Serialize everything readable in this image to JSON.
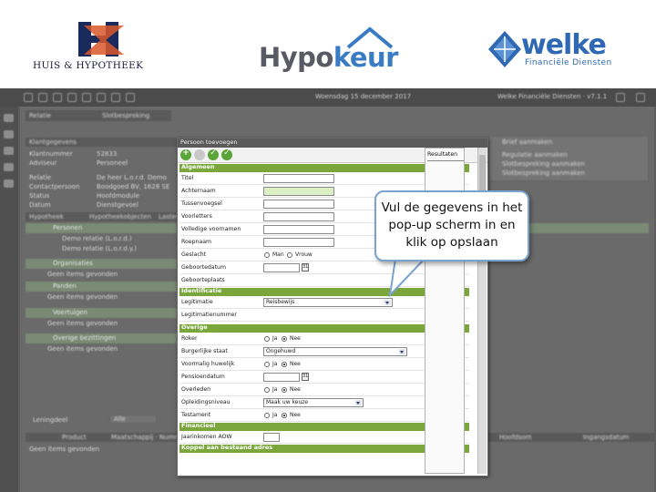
{
  "logos": {
    "huis_hypotheek": "HUIS & HYPOTHEEK",
    "hypokeur_a": "Hypo",
    "hypokeur_b": "keur",
    "welke": "welke",
    "welke_sub": "Financiële Diensten"
  },
  "colors": {
    "section_green": "#7aa63c",
    "required_field": "#dcf0c6",
    "welke_blue": "#2f69b4",
    "hypokeur_blue": "#3a7cc4",
    "callout_border": "#7aa2d0"
  },
  "app": {
    "topbar_date": "Woensdag 15 december 2017",
    "topbar_user": "Welke Financiële Diensten · v7.1.1",
    "tab_label": "Relatie",
    "tab_sub": "Slotbespreking",
    "relatie_header": "Klantgegevens",
    "right_panel": {
      "title": "Brief aanmaken",
      "items": [
        "Regulatie aanmaken",
        "Slotbespreking aanmaken",
        "Slotbespreking aanmaken"
      ]
    },
    "left_rows": [
      {
        "label": "Klantnummer",
        "value": "52833"
      },
      {
        "label": "Adviseur",
        "value": "Personeel"
      },
      {
        "label": "Relatie",
        "value": "De heer L.o.r.d. Demo"
      },
      {
        "label": "Contactpersoon",
        "value": "Boodgoed BV, 1628 SE"
      },
      {
        "label": "Status",
        "value": "Hoofdmodule"
      },
      {
        "label": "Datum",
        "value": "Dienstgevoel"
      }
    ],
    "tabs": [
      "Hypotheek",
      "Hypotheekobjecten",
      "Lasten"
    ],
    "sections": [
      {
        "title": "Personen",
        "rows": [
          "Demo relatie (L.o.r.d.)",
          "Demo relatie (L.o.r.d.y.)"
        ]
      },
      {
        "title": "Organisaties",
        "rows": [
          "Geen items gevonden"
        ]
      },
      {
        "title": "Panden",
        "rows": [
          "Geen items gevonden"
        ]
      },
      {
        "title": "Voertuigen",
        "rows": [
          "Geen items gevonden"
        ]
      },
      {
        "title": "Overige bezittingen",
        "rows": [
          "Geen items gevonden"
        ]
      }
    ],
    "bottom_label": "Leningdeel",
    "bottom_select": "Alle",
    "bottom_table_headers": [
      "Product",
      "Maatschappij · Nummer",
      "Hoofdsom",
      "Ingangsdatum"
    ],
    "bottom_empty": "Geen items gevonden"
  },
  "popup": {
    "title": "Persoon toevoegen",
    "sections": {
      "algemeen": "Algemeen",
      "identificatie": "Identificatie",
      "overige": "Overige",
      "financieel": "Financieel",
      "koppel": "Koppel aan bestaand adres"
    },
    "fields": {
      "titel": "Titel",
      "achternaam": "Achternaam",
      "tussenvoegsel": "Tussenvoegsel",
      "voorletters": "Voorletters",
      "volledige_voornamen": "Volledige voornamen",
      "roepnaam": "Roepnaam",
      "geslacht": "Geslacht",
      "geboortedatum": "Geboortedatum",
      "geboorteplaats": "Geboorteplaats",
      "legitimatie": "Legitimatie",
      "legitimatie_value": "Reisbewijs",
      "legitimatie_nummer": "Legitimatienummer",
      "roker": "Roker",
      "burgerlijke_staat": "Burgerlijke staat",
      "burgerlijke_staat_value": "Ongehuwd",
      "voormalig_huwelijk": "Voormalig huwelijk",
      "pensioendatum": "Pensioendatum",
      "overleden": "Overleden",
      "opleidingsniveau": "Opleidingsniveau",
      "opleidingsniveau_value": "Maak uw keuze",
      "testament": "Testament",
      "jaarinkomen": "Jaarinkomen AOW"
    },
    "radio_options": {
      "man": "Man",
      "vrouw": "Vrouw",
      "ja": "Ja",
      "nee": "Nee"
    },
    "calendar_glyph": "31",
    "result_panel_title": "Resultaten"
  },
  "callout": {
    "text": "Vul de gegevens in het pop-up scherm in en klik op opslaan"
  }
}
